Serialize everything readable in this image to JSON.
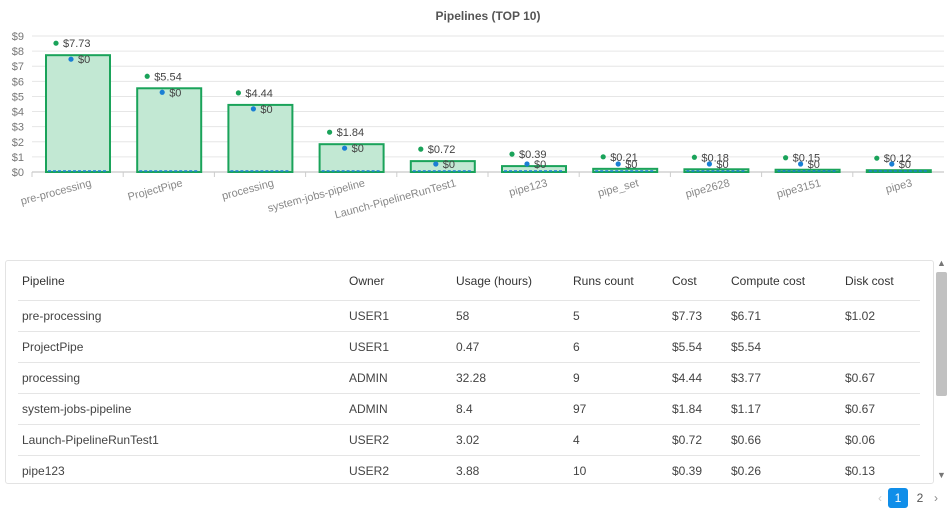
{
  "chart_data": {
    "type": "bar",
    "title": "Pipelines  (TOP 10)",
    "categories": [
      "pre-processing",
      "ProjectPipe",
      "processing",
      "system-jobs-pipeline",
      "Launch-PipelineRunTest1",
      "pipe123",
      "pipe_set",
      "pipe2628",
      "pipe3151",
      "pipe3"
    ],
    "series": [
      {
        "values": [
          7.73,
          5.54,
          4.44,
          1.84,
          0.72,
          0.39,
          0.21,
          0.18,
          0.15,
          0.12
        ],
        "labels": [
          "$7.73",
          "$5.54",
          "$4.44",
          "$1.84",
          "$0.72",
          "$0.39",
          "$0.21",
          "$0.18",
          "$0.15",
          "$0.12"
        ],
        "color": "#1aa35a",
        "fill": "#c2e8d3"
      },
      {
        "values": [
          0,
          0,
          0,
          0,
          0,
          0,
          0,
          0,
          0,
          0
        ],
        "labels": [
          "$0",
          "$0",
          "$0",
          "$0",
          "$0",
          "$0",
          "$0",
          "$0",
          "$0",
          "$0"
        ],
        "color": "#1a7fd4"
      }
    ],
    "ylim": [
      0,
      9
    ],
    "yticks": [
      "$0",
      "$1",
      "$2",
      "$3",
      "$4",
      "$5",
      "$6",
      "$7",
      "$8",
      "$9"
    ],
    "grid": true
  },
  "table": {
    "headers": [
      "Pipeline",
      "Owner",
      "Usage (hours)",
      "Runs count",
      "Cost",
      "Compute cost",
      "Disk cost"
    ],
    "rows": [
      [
        "pre-processing",
        "USER1",
        "58",
        "5",
        "$7.73",
        "$6.71",
        "$1.02"
      ],
      [
        "ProjectPipe",
        "USER1",
        "0.47",
        "6",
        "$5.54",
        "$5.54",
        ""
      ],
      [
        "processing",
        "ADMIN",
        "32.28",
        "9",
        "$4.44",
        "$3.77",
        "$0.67"
      ],
      [
        "system-jobs-pipeline",
        "ADMIN",
        "8.4",
        "97",
        "$1.84",
        "$1.17",
        "$0.67"
      ],
      [
        "Launch-PipelineRunTest1",
        "USER2",
        "3.02",
        "4",
        "$0.72",
        "$0.66",
        "$0.06"
      ],
      [
        "pipe123",
        "USER2",
        "3.88",
        "10",
        "$0.39",
        "$0.26",
        "$0.13"
      ]
    ]
  },
  "pagination": {
    "prev": "‹",
    "pages": [
      "1",
      "2"
    ],
    "current": "1",
    "next": "›"
  },
  "scrollbar": {
    "up": "▲",
    "down": "▼"
  }
}
